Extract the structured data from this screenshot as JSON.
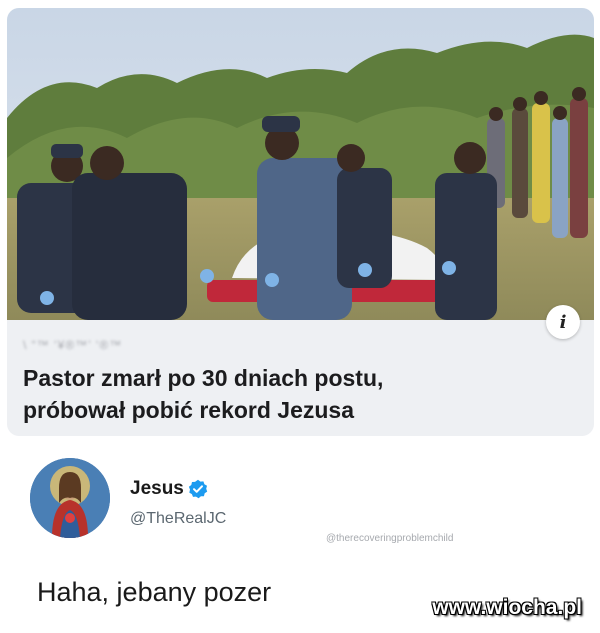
{
  "article": {
    "source_label": "\\ “™ ‘¥®™’ ‘®™",
    "headline_line1": "Pastor zmarł po 30 dniach postu,",
    "headline_line2": "próbował pobić rekord Jezusa",
    "info_icon": "info-icon"
  },
  "tweet": {
    "display_name": "Jesus",
    "handle": "@TheRealJC",
    "verified_icon": "verified-badge-icon",
    "verified_color": "#1d9bf0",
    "text": "Haha, jebany pozer"
  },
  "watermarks": {
    "username": "@therecoveringproblemchild",
    "site": "www.wiocha.pl"
  }
}
